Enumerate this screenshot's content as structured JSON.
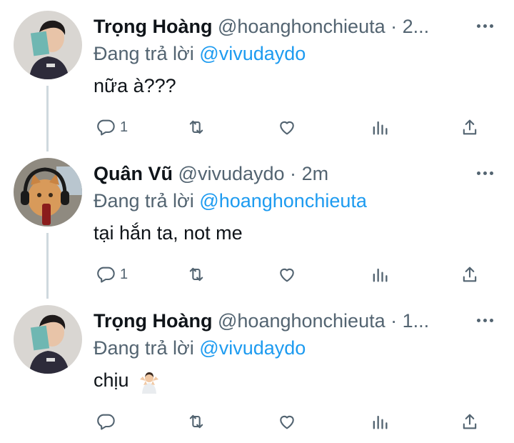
{
  "tweets": [
    {
      "name": "Trọng Hoàng",
      "handle": "@hoanghonchieuta",
      "dot": "·",
      "time": "2...",
      "replying_prefix": "Đang trả lời",
      "replying_to": "@vivudaydo",
      "text": "nữa à???",
      "reply_count": "1",
      "avatar": "man-holding-book-avatar"
    },
    {
      "name": "Quân Vũ",
      "handle": "@vivudaydo",
      "dot": "·",
      "time": "2m",
      "replying_prefix": "Đang trả lời",
      "replying_to": "@hoanghonchieuta",
      "text": "tại hắn ta, not me",
      "reply_count": "1",
      "avatar": "cat-with-headphones-avatar"
    },
    {
      "name": "Trọng Hoàng",
      "handle": "@hoanghonchieuta",
      "dot": "·",
      "time": "1...",
      "replying_prefix": "Đang trả lời",
      "replying_to": "@vivudaydo",
      "text": "chịu",
      "emoji": "person-shrugging-emoji",
      "reply_count": "",
      "avatar": "man-holding-book-avatar"
    }
  ],
  "icons": {
    "reply": "reply-icon",
    "retweet": "retweet-icon",
    "like": "like-icon",
    "views": "views-icon",
    "share": "share-icon",
    "more": "more-icon"
  },
  "colors": {
    "text": "#0f1419",
    "secondary": "#536471",
    "link": "#1d9bf0",
    "thread_line": "#cfd9de"
  }
}
